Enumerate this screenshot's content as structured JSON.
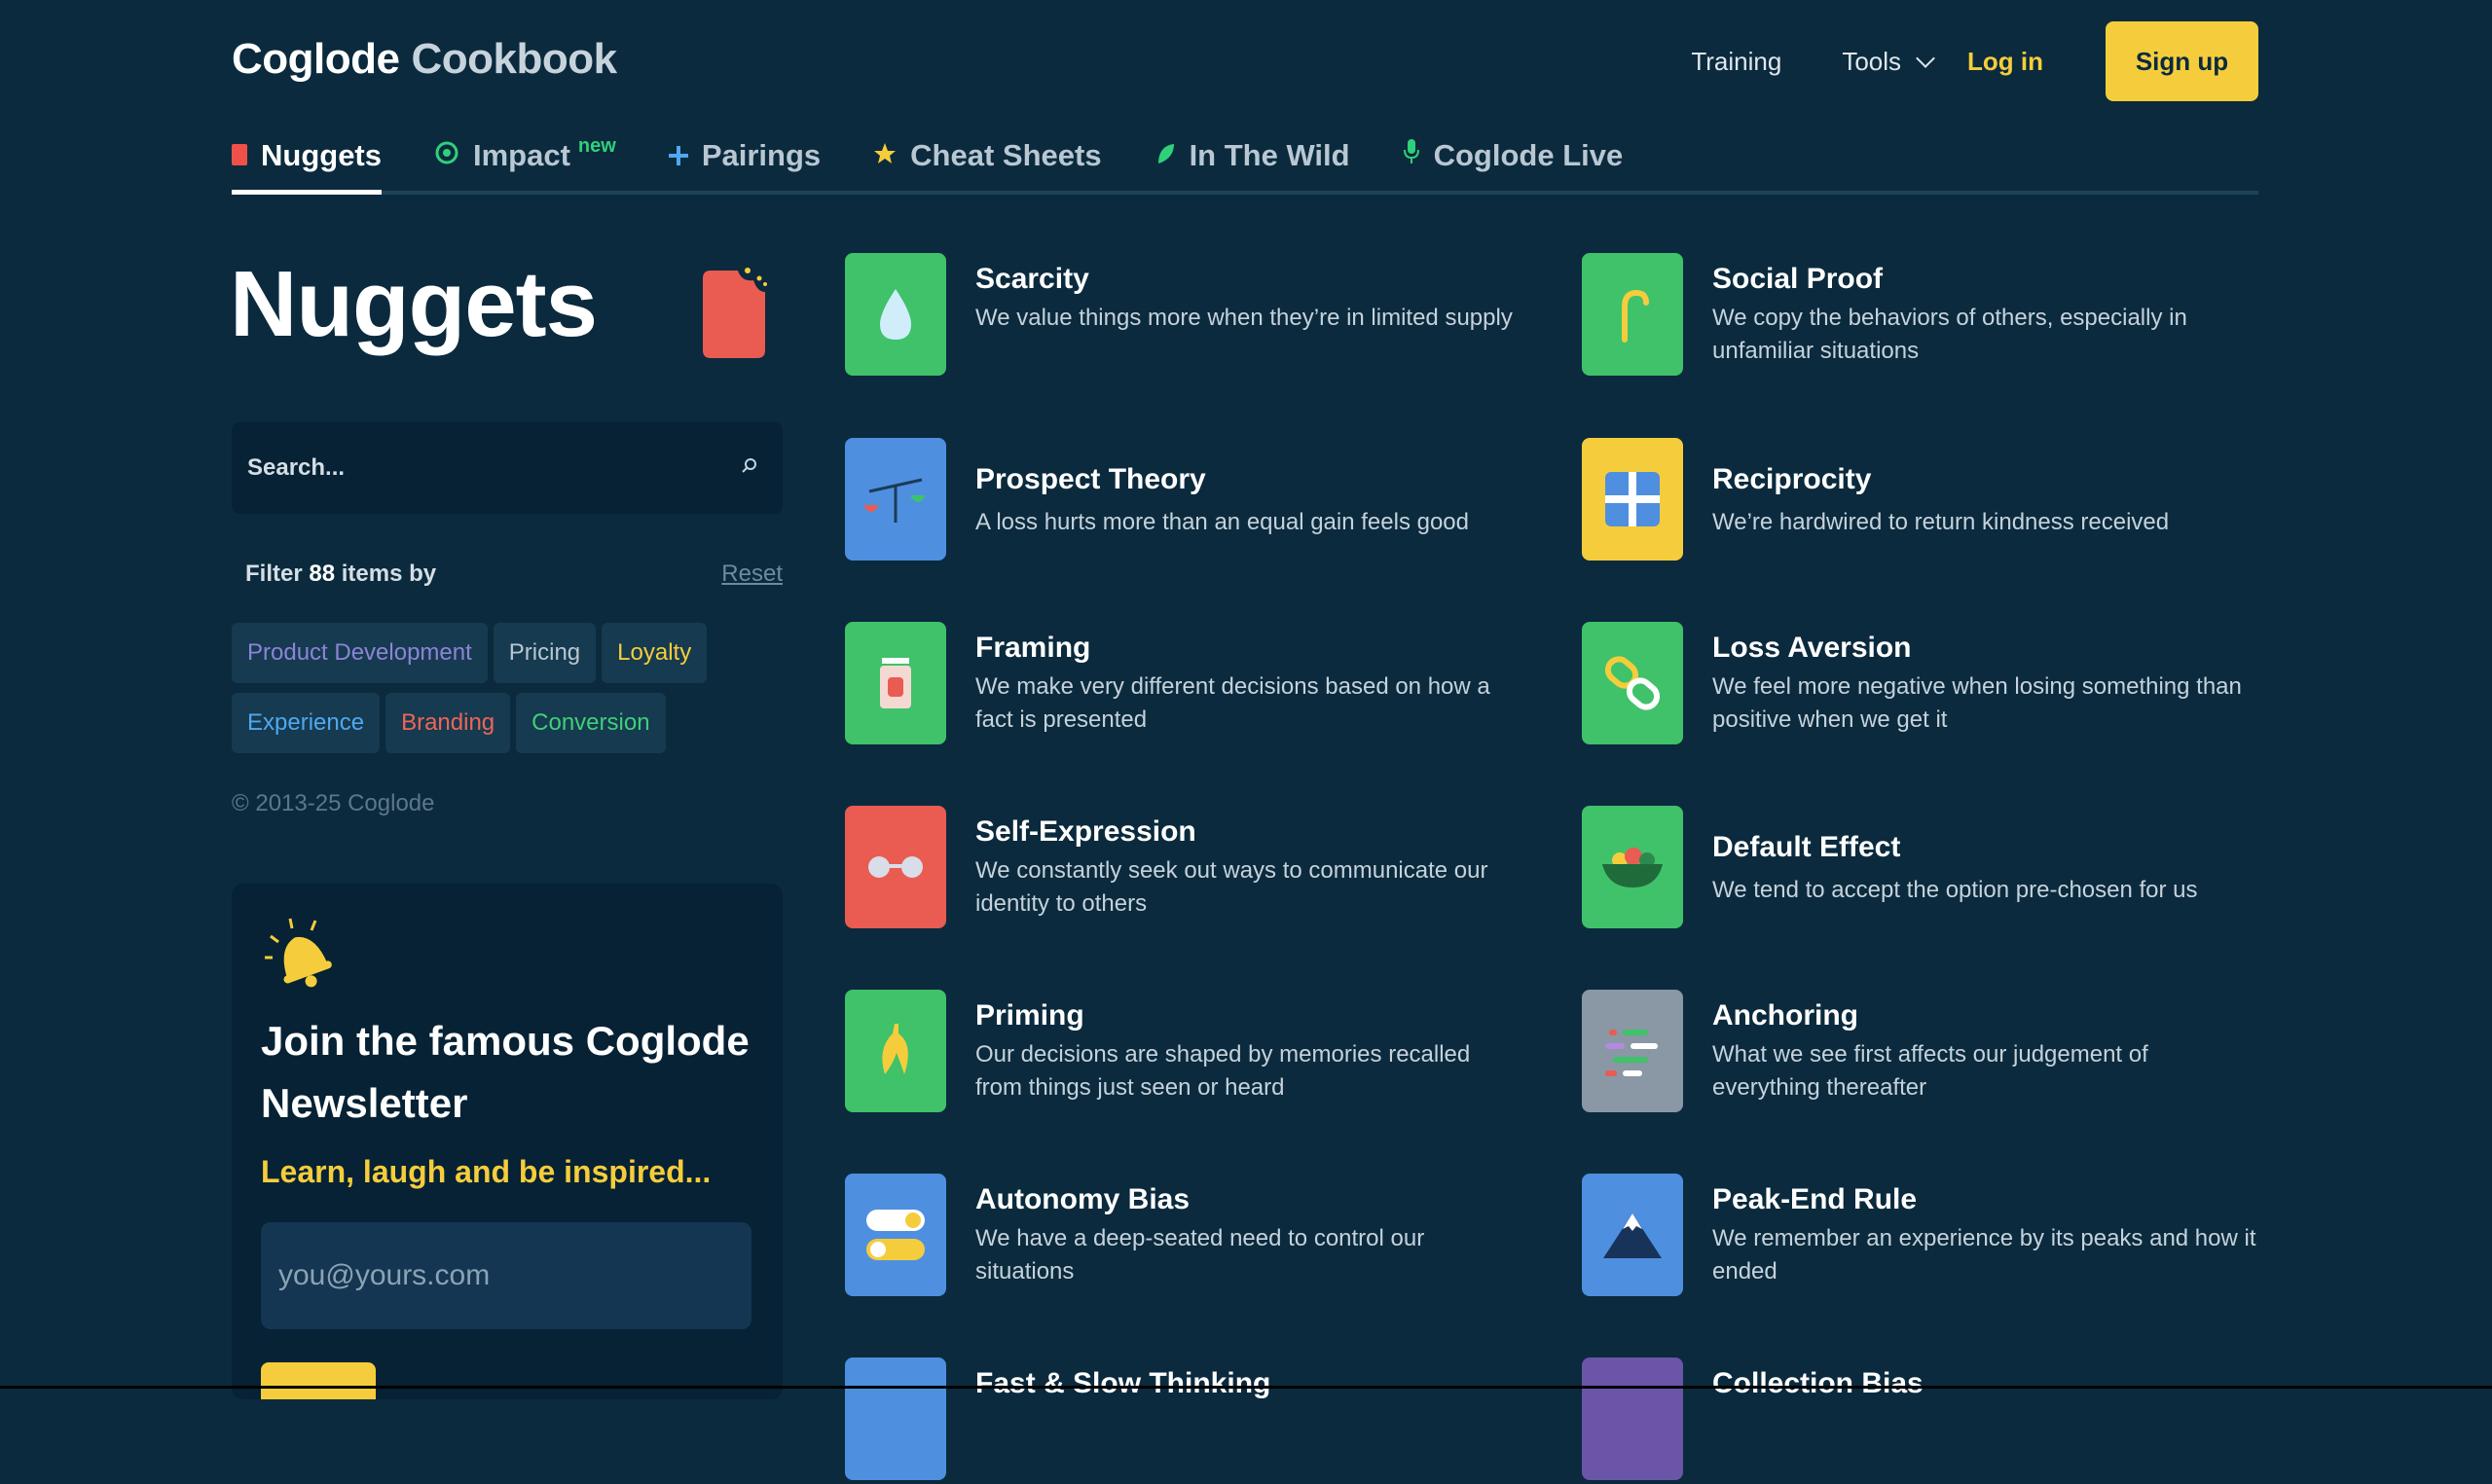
{
  "header": {
    "brand_primary": "Coglode",
    "brand_secondary": "Cookbook",
    "nav": {
      "training": "Training",
      "tools": "Tools",
      "login": "Log in",
      "signup": "Sign up"
    }
  },
  "tabs": [
    {
      "label": "Nuggets",
      "icon": "red-square-icon",
      "active": true
    },
    {
      "label": "Impact",
      "badge": "new",
      "icon": "target-icon"
    },
    {
      "label": "Pairings",
      "icon": "plus-icon"
    },
    {
      "label": "Cheat Sheets",
      "icon": "star-icon"
    },
    {
      "label": "In The Wild",
      "icon": "leaf-icon"
    },
    {
      "label": "Coglode Live",
      "icon": "microphone-icon"
    }
  ],
  "sidebar": {
    "title": "Nuggets",
    "search_placeholder": "Search...",
    "filter_prefix": "Filter",
    "filter_count": "88",
    "filter_suffix": "items by",
    "reset": "Reset",
    "chips": [
      {
        "label": "Product Development",
        "color": "#8c84d8"
      },
      {
        "label": "Pricing",
        "color": "#b8c7d2"
      },
      {
        "label": "Loyalty",
        "color": "#f5cd3c"
      },
      {
        "label": "Experience",
        "color": "#4fa8f0"
      },
      {
        "label": "Branding",
        "color": "#f0645a"
      },
      {
        "label": "Conversion",
        "color": "#3fcf7a"
      }
    ],
    "copyright": "© 2013-25 Coglode"
  },
  "newsletter": {
    "heading": "Join the famous Coglode Newsletter",
    "tagline": "Learn, laugh and be inspired...",
    "email_placeholder": "you@yours.com"
  },
  "nuggets": [
    {
      "title": "Scarcity",
      "desc": "We value things more when they’re in limited supply",
      "color": "#3fc26a",
      "icon": "water-drop-icon"
    },
    {
      "title": "Social Proof",
      "desc": "We copy the behaviors of others, especially in unfamiliar situations",
      "color": "#3fc26a",
      "icon": "cane-icon"
    },
    {
      "title": "Prospect Theory",
      "desc": "A loss hurts more than an equal gain feels good",
      "color": "#4f8fe0",
      "icon": "scales-icon"
    },
    {
      "title": "Reciprocity",
      "desc": "We’re hardwired to return kindness received",
      "color": "#f5cd3c",
      "icon": "gift-icon"
    },
    {
      "title": "Framing",
      "desc": "We make very different decisions based on how a fact is presented",
      "color": "#3fc26a",
      "icon": "jar-icon"
    },
    {
      "title": "Loss Aversion",
      "desc": "We feel more negative when losing something than positive when we get it",
      "color": "#3fc26a",
      "icon": "chain-link-icon"
    },
    {
      "title": "Self-Expression",
      "desc": "We constantly seek out ways to communicate our identity to others",
      "color": "#ea5b52",
      "icon": "glasses-icon"
    },
    {
      "title": "Default Effect",
      "desc": "We tend to accept the option pre-chosen for us",
      "color": "#3fc26a",
      "icon": "salad-bowl-icon"
    },
    {
      "title": "Priming",
      "desc": "Our decisions are shaped by memories recalled from things just seen or heard",
      "color": "#3fc26a",
      "icon": "banana-icon"
    },
    {
      "title": "Anchoring",
      "desc": "What we see first affects our judgement of everything thereafter",
      "color": "#8a97a5",
      "icon": "list-lines-icon"
    },
    {
      "title": "Autonomy Bias",
      "desc": "We have a deep-seated need to control our situations",
      "color": "#4f8fe0",
      "icon": "toggle-switches-icon"
    },
    {
      "title": "Peak-End Rule",
      "desc": "We remember an experience by its peaks and how it ended",
      "color": "#4f8fe0",
      "icon": "mountain-icon"
    },
    {
      "title": "Fast & Slow Thinking",
      "desc": "",
      "color": "#4f8fe0",
      "icon": "partial-icon"
    },
    {
      "title": "Collection Bias",
      "desc": "",
      "color": "#6a55a8",
      "icon": "partial-icon"
    }
  ]
}
